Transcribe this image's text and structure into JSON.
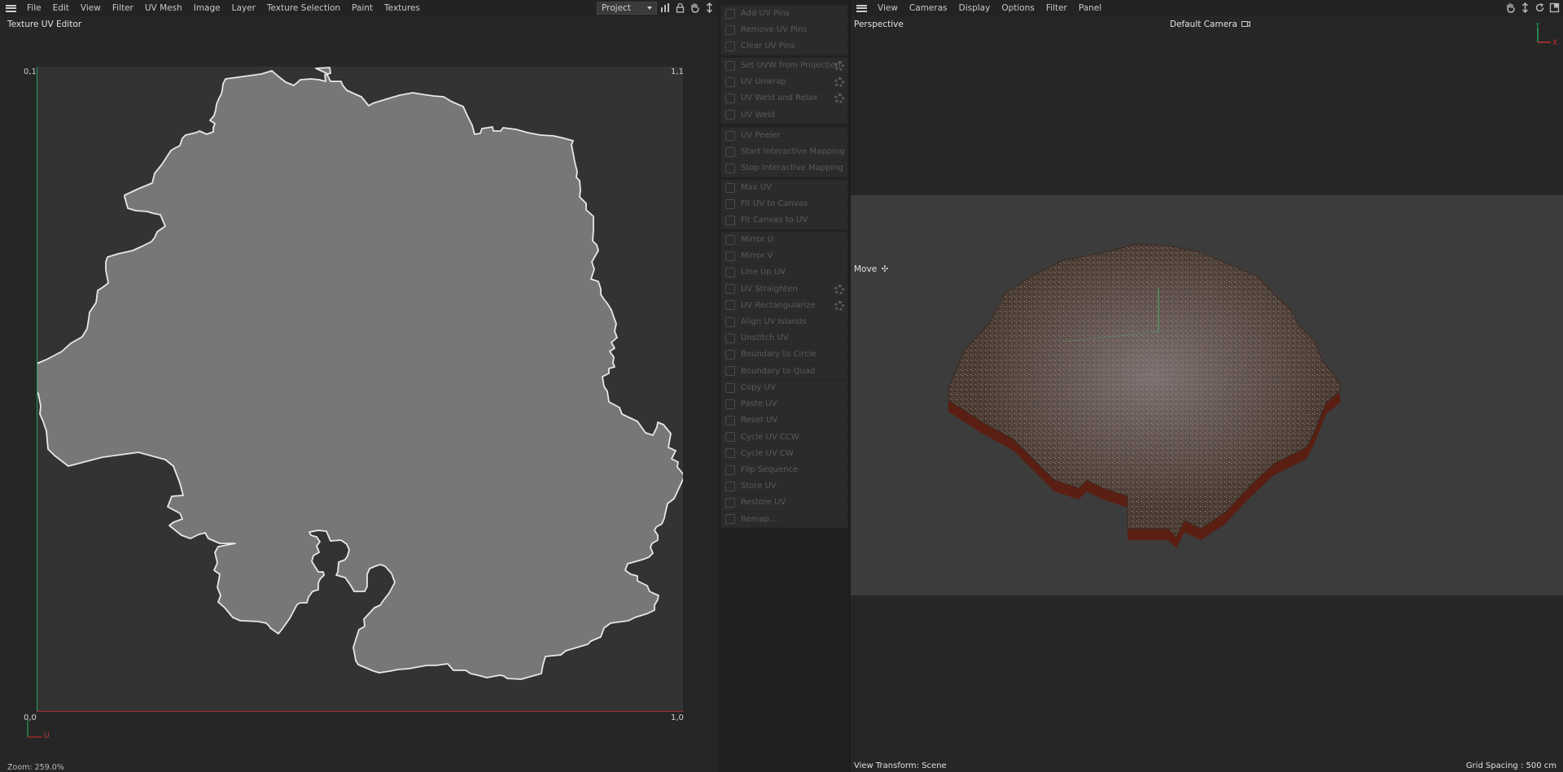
{
  "uv_editor": {
    "menu": [
      "File",
      "Edit",
      "View",
      "Filter",
      "UV Mesh",
      "Image",
      "Layer",
      "Texture Selection",
      "Paint",
      "Textures"
    ],
    "project_select": "Project",
    "title": "Texture UV Editor",
    "coords": {
      "top_left": "0,1",
      "top_right": "1,1",
      "bottom_left": "0,0",
      "bottom_right": "1,0"
    },
    "axis_label_u": "U",
    "zoom": "Zoom: 259.0%",
    "colors": {
      "canvas_bg": "#333333",
      "uv_fill": "#777777",
      "uv_stroke": "#e8e8e8",
      "v_axis": "#2aa05a",
      "u_axis": "#b03030"
    }
  },
  "commands": {
    "groups": [
      [
        {
          "label": "Add UV Pins",
          "icon": "pin-icon"
        },
        {
          "label": "Remove UV Pins",
          "icon": "pin-remove-icon"
        },
        {
          "label": "Clear UV Pins",
          "icon": "clear-icon"
        }
      ],
      [
        {
          "label": "Set UVW from Projection",
          "icon": "projection-icon",
          "gear": true
        },
        {
          "label": "UV Unwrap",
          "icon": "unwrap-icon",
          "gear": true
        },
        {
          "label": "UV Weld and Relax",
          "icon": "weld-relax-icon",
          "gear": true
        },
        {
          "label": "UV Weld",
          "icon": "weld-icon"
        }
      ],
      [
        {
          "label": "UV Peeler",
          "icon": "peeler-icon"
        },
        {
          "label": "Start Interactive Mapping",
          "icon": "play-icon"
        },
        {
          "label": "Stop Interactive Mapping",
          "icon": "stop-icon"
        }
      ],
      [
        {
          "label": "Max UV",
          "icon": "max-uv-icon"
        },
        {
          "label": "Fit UV to Canvas",
          "icon": "fit-uv-icon"
        },
        {
          "label": "Fit Canvas to UV",
          "icon": "fit-canvas-icon"
        }
      ],
      [
        {
          "label": "Mirror U",
          "icon": "mirror-u-icon"
        },
        {
          "label": "Mirror V",
          "icon": "mirror-v-icon"
        },
        {
          "label": "Line Up UV",
          "icon": "line-up-icon"
        },
        {
          "label": "UV Straighten",
          "icon": "straighten-icon",
          "gear": true
        },
        {
          "label": "UV Rectangularize",
          "icon": "rectangularize-icon",
          "gear": true
        },
        {
          "label": "Align UV Islands",
          "icon": "align-icon"
        },
        {
          "label": "Unstitch UV",
          "icon": "unstitch-icon"
        },
        {
          "label": "Boundary to Circle",
          "icon": "circle-icon"
        },
        {
          "label": "Boundary to Quad",
          "icon": "quad-icon"
        }
      ],
      [
        {
          "label": "Copy UV",
          "icon": "copy-icon"
        },
        {
          "label": "Paste UV",
          "icon": "paste-icon"
        },
        {
          "label": "Reset UV",
          "icon": "reset-icon"
        },
        {
          "label": "Cycle UV CCW",
          "icon": "cycle-ccw-icon"
        },
        {
          "label": "Cycle UV CW",
          "icon": "cycle-cw-icon"
        },
        {
          "label": "Flip Sequence",
          "icon": "flip-icon"
        },
        {
          "label": "Store UV",
          "icon": "store-icon"
        },
        {
          "label": "Restore UV",
          "icon": "restore-icon"
        },
        {
          "label": "Remap...",
          "icon": "remap-icon"
        }
      ]
    ]
  },
  "viewport": {
    "menu": [
      "View",
      "Cameras",
      "Display",
      "Options",
      "Filter",
      "Panel"
    ],
    "view_name": "Perspective",
    "camera": "Default Camera",
    "tool": "Move",
    "view_transform": "View Transform: Scene",
    "grid_spacing": "Grid Spacing : 500 cm",
    "axis_y": "Y",
    "axis_x": "X",
    "colors": {
      "band_bg": "#3c3c3c",
      "terrain_top": "#4a3b33",
      "terrain_side": "#5a1f12"
    }
  }
}
